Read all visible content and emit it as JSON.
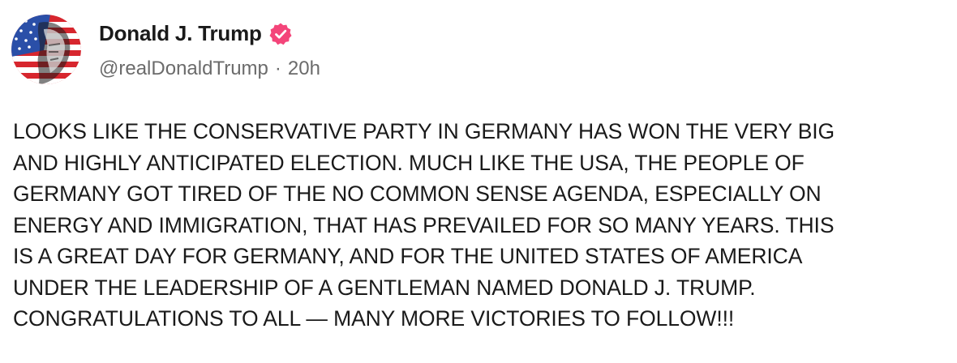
{
  "post": {
    "author": {
      "display_name": "Donald J. Trump",
      "handle": "@realDonaldTrump",
      "separator": "·",
      "time_ago": "20h",
      "verified_icon": "verified-badge-icon",
      "avatar_icon": "profile-avatar",
      "verified_color": "#f4457a"
    },
    "text": "LOOKS LIKE THE CONSERVATIVE PARTY  IN GERMANY HAS WON THE VERY BIG\nAND HIGHLY ANTICIPATED ELECTION. MUCH LIKE THE USA, THE PEOPLE OF\nGERMANY GOT TIRED OF THE NO COMMON SENSE AGENDA, ESPECIALLY ON\nENERGY AND IMMIGRATION, THAT HAS PREVAILED FOR SO MANY YEARS. THIS\nIS A GREAT DAY FOR GERMANY, AND FOR THE UNITED STATES OF AMERICA\nUNDER THE LEADERSHIP OF A GENTLEMAN NAMED DONALD J. TRUMP.\nCONGRATULATIONS TO ALL — MANY MORE VICTORIES TO FOLLOW!!!"
  }
}
